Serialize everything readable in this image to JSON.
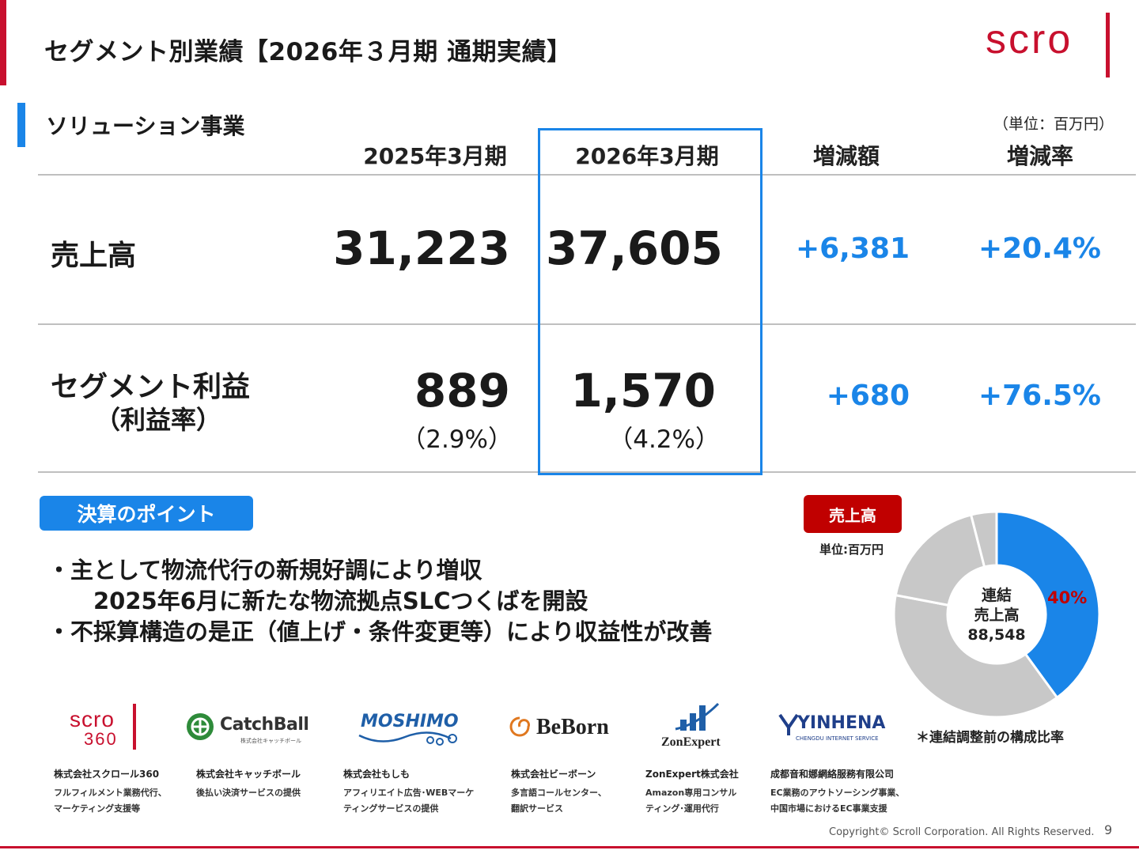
{
  "header": {
    "title": "セグメント別業績【2026年３月期 通期実績】",
    "logo_text": "scro"
  },
  "section": {
    "title": "ソリューション事業",
    "unit": "（単位：百万円）"
  },
  "table": {
    "columns": [
      "2025年3月期",
      "2026年3月期",
      "増減額",
      "増減率"
    ],
    "rows": [
      {
        "label": "売上高",
        "sublabel": "",
        "fy2025": "31,223",
        "fy2025_sub": "",
        "fy2026": "37,605",
        "fy2026_sub": "",
        "change": "+6,381",
        "rate": "+20.4%"
      },
      {
        "label": "セグメント利益",
        "sublabel": "（利益率）",
        "fy2025": "889",
        "fy2025_sub": "（2.9%）",
        "fy2026": "1,570",
        "fy2026_sub": "（4.2%）",
        "change": "+680",
        "rate": "+76.5%"
      }
    ]
  },
  "points": {
    "label": "決算のポイント",
    "items": [
      "・主として物流代行の新規好調により増収",
      "2025年6月に新たな物流拠点SLCつくばを開設",
      "・不採算構造の是正（値上げ・条件変更等）により収益性が改善"
    ]
  },
  "pie": {
    "badge": "売上高",
    "unit": "単位:百万円",
    "center_lines": [
      "連結",
      "売上高",
      "88,548"
    ],
    "highlight_label": "40%",
    "note": "＊連結調整前の構成比率",
    "slices": [
      {
        "value": 40,
        "color": "#1a85e8"
      },
      {
        "value": 38,
        "color": "#c8c8c8"
      },
      {
        "value": 18,
        "color": "#c8c8c8"
      },
      {
        "value": 4,
        "color": "#c8c8c8"
      }
    ]
  },
  "companies": [
    {
      "logo": "scroll360",
      "name": "株式会社スクロール360",
      "desc": [
        "フルフィルメント業務代行、",
        "マーケティング支援等"
      ]
    },
    {
      "logo": "CatchBall",
      "name": "株式会社キャッチボール",
      "desc": [
        "後払い決済サービスの提供"
      ]
    },
    {
      "logo": "MOSHIMO",
      "name": "株式会社もしも",
      "desc": [
        "アフィリエイト広告･WEBマーケ",
        "ティングサービスの提供"
      ]
    },
    {
      "logo": "BeBorn",
      "name": "株式会社ビーボーン",
      "desc": [
        "多言語コールセンター、",
        "翻訳サービス"
      ]
    },
    {
      "logo": "ZonExpert",
      "name": "ZonExpert株式会社",
      "desc": [
        "Amazon専用コンサル",
        "ティング･運用代行"
      ]
    },
    {
      "logo": "YINHENA",
      "name": "成都音和娜網絡服務有限公司",
      "desc": [
        "EC業務のアウトソーシング事業、",
        "中国市場におけるEC事業支援"
      ]
    }
  ],
  "logos": {
    "scroll360_top": "scro",
    "scroll360_bottom": "360",
    "catchball": "CatchBall",
    "catchball_sub": "株式会社キャッチボール",
    "moshimo": "MOSHIMO",
    "beborn": "BeBorn",
    "zonexpert": "ZonExpert",
    "yinhena": "YINHENA",
    "yinhena_sub": "CHENGDU INTERNET SERVICE"
  },
  "footer": {
    "copyright": "Copyright© Scroll Corporation. All Rights Reserved.",
    "page": "9"
  },
  "colors": {
    "accent": "#1a85e8",
    "brand": "#c8102e"
  }
}
